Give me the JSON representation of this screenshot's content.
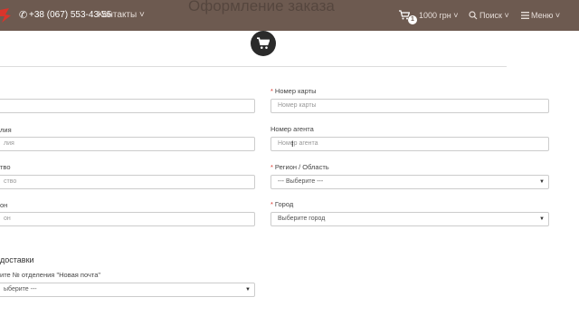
{
  "header": {
    "phone": "+38 (067) 553-43-55",
    "contacts": "Контакты ˅",
    "cart_count": "1",
    "price": "1000 грн ˅",
    "search": "Поиск ˅",
    "menu": "Меню ˅",
    "page_title": "Оформление заказа"
  },
  "left_form": {
    "label2": "лия",
    "placeholder2": "лия",
    "label3": "тво",
    "placeholder3": "ство",
    "label4": "он",
    "placeholder4": "он",
    "section_title": "доставки",
    "np_label": "ите № отделения \"Новая почта\"",
    "np_select": "ыберите ---"
  },
  "right_form": {
    "card_label": "Номер карты",
    "card_placeholder": "Номер карты",
    "agent_label": "Номер агента",
    "agent_placeholder": "Номер агента",
    "region_label": "Регион / Область",
    "region_select": "--- Выберите ---",
    "city_label": "Город",
    "city_select": "Выберите город"
  },
  "colors": {
    "header_bg": "#6d5a50",
    "required_mark": "#d9342b"
  },
  "icons": [
    "logo-icon",
    "phone-icon",
    "cart-icon",
    "search-icon",
    "menu-icon"
  ]
}
